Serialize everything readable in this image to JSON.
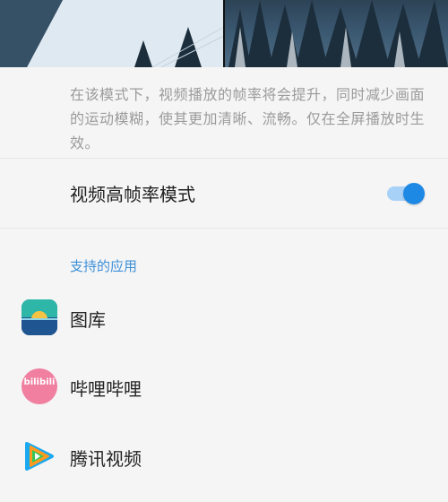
{
  "settings": {
    "description": "在该模式下，视频播放的帧率将会提升，同时减少画面的运动模糊，使其更加清晰、流畅。仅在全屏播放时生效。",
    "high_frame_rate": {
      "label": "视频高帧率模式",
      "enabled": true
    }
  },
  "supported_apps": {
    "header": "支持的应用",
    "items": [
      {
        "name": "图库",
        "icon": "gallery-icon"
      },
      {
        "name": "哔哩哔哩",
        "icon": "bilibili-icon",
        "icon_text": "bilibili"
      },
      {
        "name": "腾讯视频",
        "icon": "tencent-video-icon"
      }
    ]
  },
  "colors": {
    "accent": "#1e88e5",
    "section_header": "#3c8fd8",
    "background": "#f5f5f5"
  }
}
